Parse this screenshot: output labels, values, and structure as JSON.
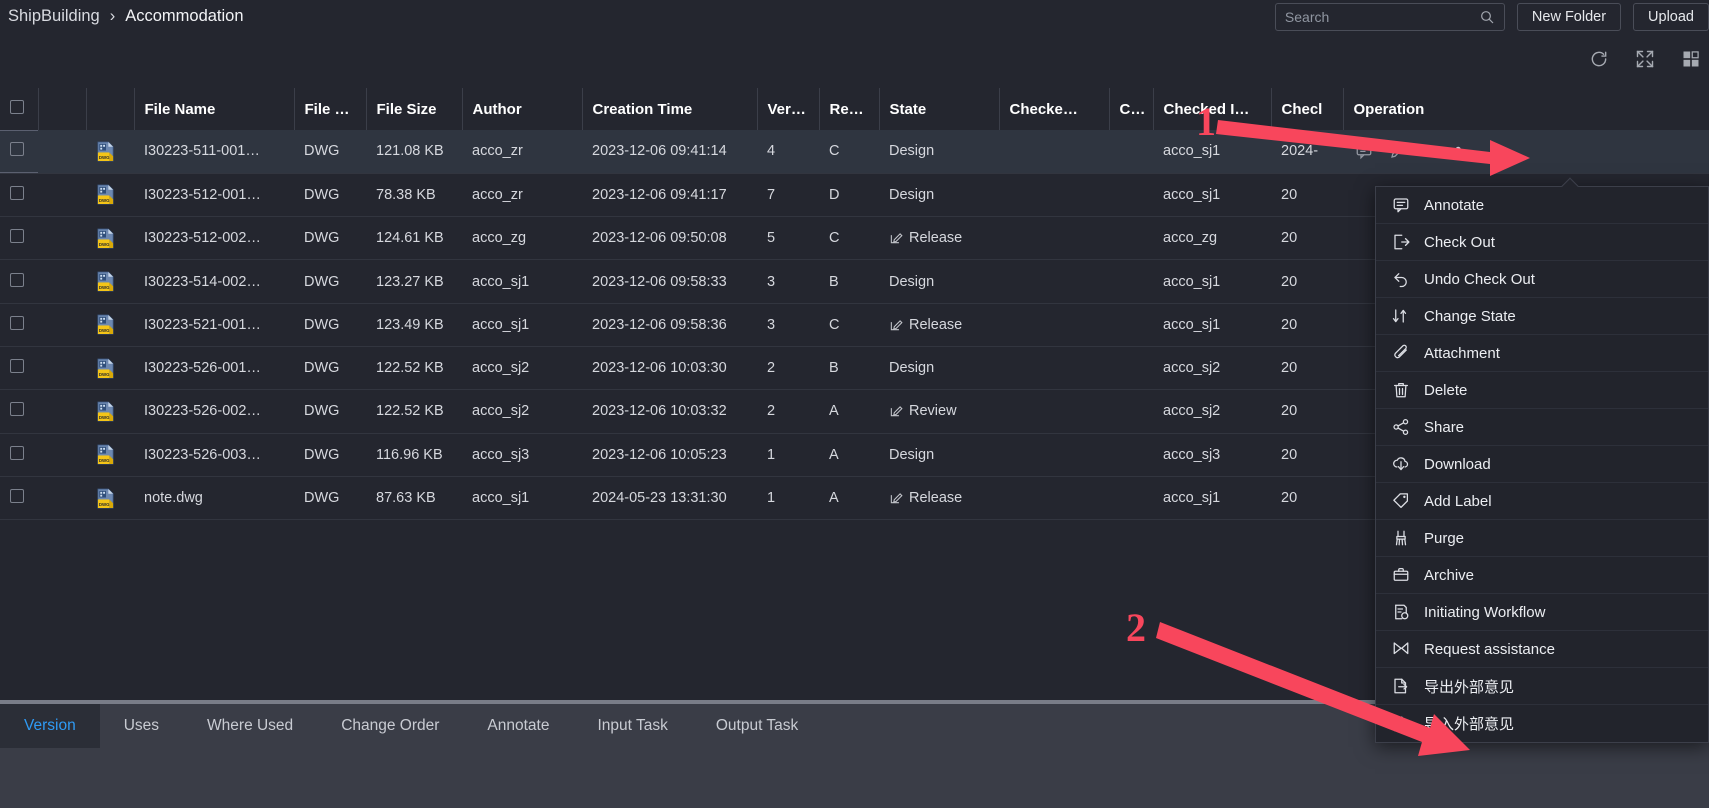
{
  "breadcrumb": {
    "root": "ShipBuilding",
    "separator": "›",
    "current": "Accommodation"
  },
  "search": {
    "placeholder": "Search",
    "value": "",
    "icon": "search-icon"
  },
  "header_buttons": {
    "new_folder": "New Folder",
    "upload": "Upload"
  },
  "toolbar_icons": [
    "refresh-icon",
    "fullscreen-icon",
    "grid-view-icon"
  ],
  "table": {
    "columns": [
      {
        "key": "checkbox",
        "label": ""
      },
      {
        "key": "gap",
        "label": ""
      },
      {
        "key": "icon",
        "label": ""
      },
      {
        "key": "file_name",
        "label": "File Name"
      },
      {
        "key": "file_type",
        "label": "File Type"
      },
      {
        "key": "file_size",
        "label": "File Size"
      },
      {
        "key": "author",
        "label": "Author"
      },
      {
        "key": "creation_time",
        "label": "Creation Time"
      },
      {
        "key": "version",
        "label": "Ver…"
      },
      {
        "key": "revision",
        "label": "Re…"
      },
      {
        "key": "state",
        "label": "State"
      },
      {
        "key": "checked1",
        "label": "Checke…"
      },
      {
        "key": "checked2",
        "label": "C…"
      },
      {
        "key": "checked_in",
        "label": "Checked I…"
      },
      {
        "key": "checked_in2",
        "label": "Checl"
      },
      {
        "key": "operation",
        "label": "Operation"
      }
    ],
    "rows": [
      {
        "selected": true,
        "file_name": "I30223-511-001…",
        "file_type": "DWG",
        "file_size": "121.08 KB",
        "author": "acco_zr",
        "creation_time": "2023-12-06 09:41:14",
        "version": "4",
        "revision": "C",
        "state": "Design",
        "state_editable": false,
        "checked1": "",
        "checked2": "",
        "checked_in": "acco_sj1",
        "checked_in2": "2024-",
        "show_ops": true
      },
      {
        "selected": false,
        "file_name": "I30223-512-001…",
        "file_type": "DWG",
        "file_size": "78.38 KB",
        "author": "acco_zr",
        "creation_time": "2023-12-06 09:41:17",
        "version": "7",
        "revision": "D",
        "state": "Design",
        "state_editable": false,
        "checked1": "",
        "checked2": "",
        "checked_in": "acco_sj1",
        "checked_in2": "20",
        "show_ops": false
      },
      {
        "selected": false,
        "file_name": "I30223-512-002…",
        "file_type": "DWG",
        "file_size": "124.61 KB",
        "author": "acco_zg",
        "creation_time": "2023-12-06 09:50:08",
        "version": "5",
        "revision": "C",
        "state": "Release",
        "state_editable": true,
        "checked1": "",
        "checked2": "",
        "checked_in": "acco_zg",
        "checked_in2": "20",
        "show_ops": false
      },
      {
        "selected": false,
        "file_name": "I30223-514-002…",
        "file_type": "DWG",
        "file_size": "123.27 KB",
        "author": "acco_sj1",
        "creation_time": "2023-12-06 09:58:33",
        "version": "3",
        "revision": "B",
        "state": "Design",
        "state_editable": false,
        "checked1": "",
        "checked2": "",
        "checked_in": "acco_sj1",
        "checked_in2": "20",
        "show_ops": false
      },
      {
        "selected": false,
        "file_name": "I30223-521-001…",
        "file_type": "DWG",
        "file_size": "123.49 KB",
        "author": "acco_sj1",
        "creation_time": "2023-12-06 09:58:36",
        "version": "3",
        "revision": "C",
        "state": "Release",
        "state_editable": true,
        "checked1": "",
        "checked2": "",
        "checked_in": "acco_sj1",
        "checked_in2": "20",
        "show_ops": false
      },
      {
        "selected": false,
        "file_name": "I30223-526-001…",
        "file_type": "DWG",
        "file_size": "122.52 KB",
        "author": "acco_sj2",
        "creation_time": "2023-12-06 10:03:30",
        "version": "2",
        "revision": "B",
        "state": "Design",
        "state_editable": false,
        "checked1": "",
        "checked2": "",
        "checked_in": "acco_sj2",
        "checked_in2": "20",
        "show_ops": false
      },
      {
        "selected": false,
        "file_name": "I30223-526-002…",
        "file_type": "DWG",
        "file_size": "122.52 KB",
        "author": "acco_sj2",
        "creation_time": "2023-12-06 10:03:32",
        "version": "2",
        "revision": "A",
        "state": "Review",
        "state_editable": true,
        "checked1": "",
        "checked2": "",
        "checked_in": "acco_sj2",
        "checked_in2": "20",
        "show_ops": false
      },
      {
        "selected": false,
        "file_name": "I30223-526-003…",
        "file_type": "DWG",
        "file_size": "116.96 KB",
        "author": "acco_sj3",
        "creation_time": "2023-12-06 10:05:23",
        "version": "1",
        "revision": "A",
        "state": "Design",
        "state_editable": false,
        "checked1": "",
        "checked2": "",
        "checked_in": "acco_sj3",
        "checked_in2": "20",
        "show_ops": false
      },
      {
        "selected": false,
        "file_name": "note.dwg",
        "file_type": "DWG",
        "file_size": "87.63 KB",
        "author": "acco_sj1",
        "creation_time": "2024-05-23 13:31:30",
        "version": "1",
        "revision": "A",
        "state": "Release",
        "state_editable": true,
        "checked1": "",
        "checked2": "",
        "checked_in": "acco_sj1",
        "checked_in2": "20",
        "show_ops": false
      }
    ]
  },
  "context_menu": {
    "items": [
      {
        "label": "Annotate",
        "icon": "annotate-icon"
      },
      {
        "label": "Check Out",
        "icon": "check-out-icon"
      },
      {
        "label": "Undo Check Out",
        "icon": "undo-check-out-icon"
      },
      {
        "label": "Change State",
        "icon": "change-state-icon"
      },
      {
        "label": "Attachment",
        "icon": "paperclip-icon"
      },
      {
        "label": "Delete",
        "icon": "trash-icon"
      },
      {
        "label": "Share",
        "icon": "share-icon"
      },
      {
        "label": "Download",
        "icon": "download-icon"
      },
      {
        "label": "Add Label",
        "icon": "tag-icon"
      },
      {
        "label": "Purge",
        "icon": "purge-broom-icon"
      },
      {
        "label": "Archive",
        "icon": "archive-icon"
      },
      {
        "label": "Initiating Workflow",
        "icon": "workflow-icon"
      },
      {
        "label": "Request assistance",
        "icon": "request-assistance-icon"
      },
      {
        "label": "导出外部意见",
        "icon": "export-comments-icon"
      },
      {
        "label": "导入外部意见",
        "icon": "import-comments-icon"
      }
    ]
  },
  "bottom_tabs": {
    "active": "Version",
    "items": [
      "Version",
      "Uses",
      "Where Used",
      "Change Order",
      "Annotate",
      "Input Task",
      "Output Task"
    ]
  },
  "annotations": {
    "marker1": "1",
    "marker2": "2",
    "arrow_color": "#f8465c"
  },
  "colors": {
    "accent": "#2f9bf5",
    "bg": "#24262f",
    "row_selected": "#2f3540",
    "tabbar": "#3a3d47",
    "marker": "#f8465c"
  }
}
